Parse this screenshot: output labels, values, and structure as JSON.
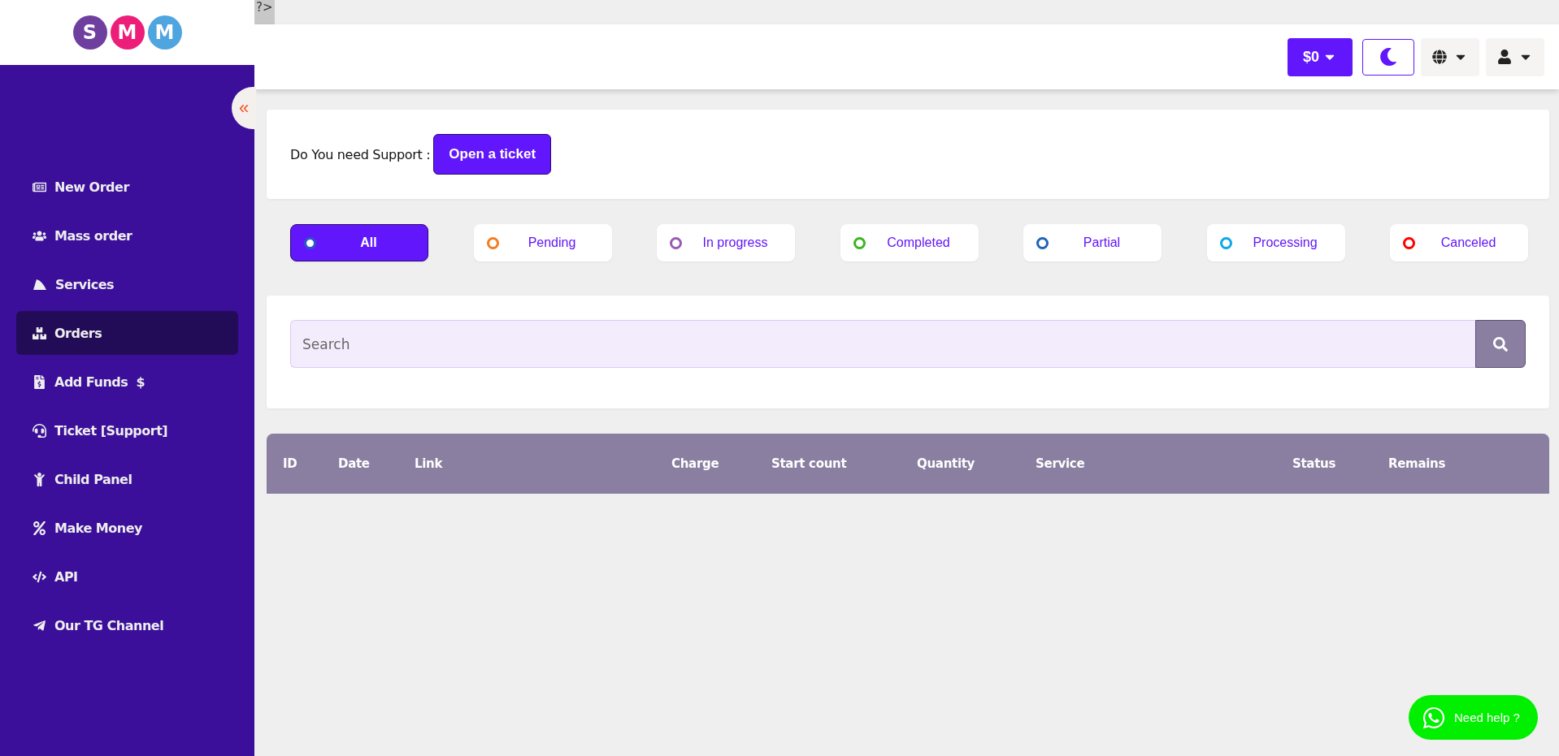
{
  "logo": {
    "letters": [
      {
        "text": "S",
        "color": "#6f3fa0"
      },
      {
        "text": "M",
        "color": "#ec1e79"
      },
      {
        "text": "M",
        "color": "#4ea5e0"
      }
    ]
  },
  "stray_text": "?>",
  "sidebar": {
    "collapse": "«",
    "items": [
      {
        "label": "New Order",
        "selected": false
      },
      {
        "label": "Mass order",
        "selected": false
      },
      {
        "label": "Services",
        "selected": false
      },
      {
        "label": "Orders",
        "selected": true
      },
      {
        "label": "Add Funds  $",
        "selected": false
      },
      {
        "label": "Ticket [Support]",
        "selected": false
      },
      {
        "label": "Child Panel",
        "selected": false
      },
      {
        "label": "Make Money",
        "selected": false
      },
      {
        "label": "API",
        "selected": false
      },
      {
        "label": "Our TG Channel",
        "selected": false
      }
    ]
  },
  "header": {
    "balance": "$0"
  },
  "support": {
    "text": "Do You need Support :",
    "button": "Open a ticket"
  },
  "filters": [
    {
      "label": "All",
      "selected": true,
      "color": "#2d55c8"
    },
    {
      "label": "Pending",
      "selected": false,
      "color": "#f57c1f"
    },
    {
      "label": "In progress",
      "selected": false,
      "color": "#9b59b6"
    },
    {
      "label": "Completed",
      "selected": false,
      "color": "#3cb521"
    },
    {
      "label": "Partial",
      "selected": false,
      "color": "#1e64b8"
    },
    {
      "label": "Processing",
      "selected": false,
      "color": "#0aa8e8"
    },
    {
      "label": "Canceled",
      "selected": false,
      "color": "#ff0000"
    }
  ],
  "search": {
    "placeholder": "Search"
  },
  "table": {
    "columns": [
      "ID",
      "Date",
      "Link",
      "Charge",
      "Start count",
      "Quantity",
      "Service",
      "Status",
      "Remains"
    ]
  },
  "help_button": "Need help ?"
}
